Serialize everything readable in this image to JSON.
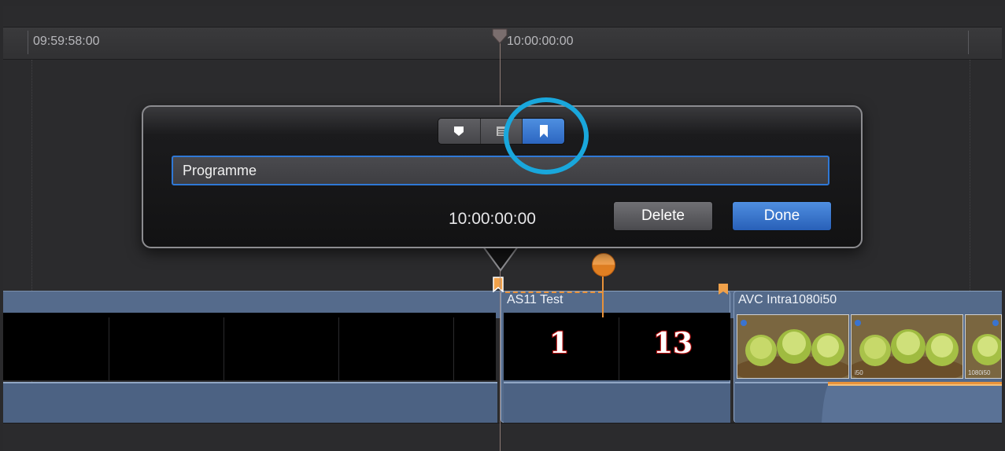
{
  "ruler": {
    "start_timecode": "09:59:58:00",
    "playhead_timecode": "10:00:00:00"
  },
  "popover": {
    "tabs": [
      {
        "name": "marker",
        "icon": "marker-shield-icon",
        "active": false
      },
      {
        "name": "notes",
        "icon": "list-icon",
        "active": false
      },
      {
        "name": "chapter",
        "icon": "bookmark-icon",
        "active": true
      }
    ],
    "name_field_value": "Programme",
    "timecode": "10:00:00:00",
    "delete_label": "Delete",
    "done_label": "Done"
  },
  "timeline": {
    "clips": [
      {
        "name": "AS11 Test",
        "numbers": [
          "1",
          "13"
        ]
      },
      {
        "name": "AVC Intra1080i50",
        "thumb_badges": [
          "i50",
          "1080i50"
        ]
      }
    ]
  },
  "colors": {
    "accent_blue": "#2c66c1",
    "highlight_ring": "#19a7dc",
    "marker_orange": "#e8923a",
    "clip_blue": "#546a8a"
  }
}
